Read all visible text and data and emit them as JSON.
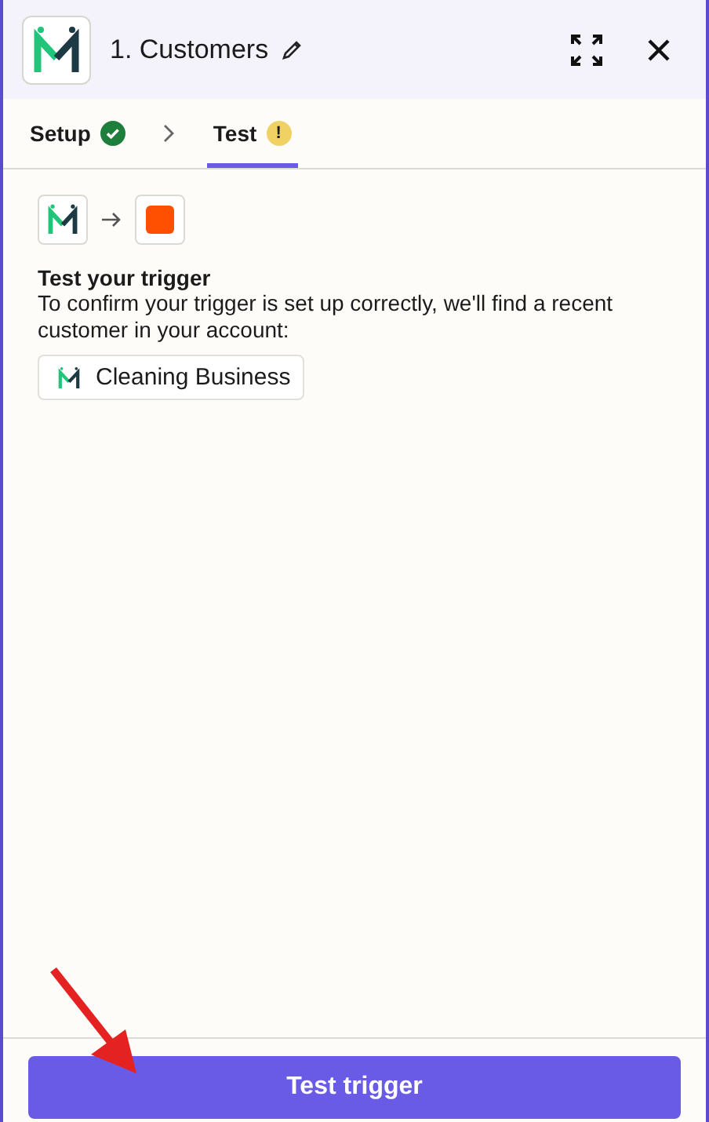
{
  "header": {
    "title": "1. Customers"
  },
  "tabs": [
    {
      "label": "Setup",
      "kind": "complete",
      "selected": false
    },
    {
      "label": "Test",
      "kind": "warning",
      "status_text": "!",
      "selected": true
    }
  ],
  "content": {
    "heading": "Test your trigger",
    "description": "To confirm your trigger is set up correctly, we'll find a recent customer in your account:",
    "account": "Cleaning Business"
  },
  "footer": {
    "button": "Test trigger"
  }
}
